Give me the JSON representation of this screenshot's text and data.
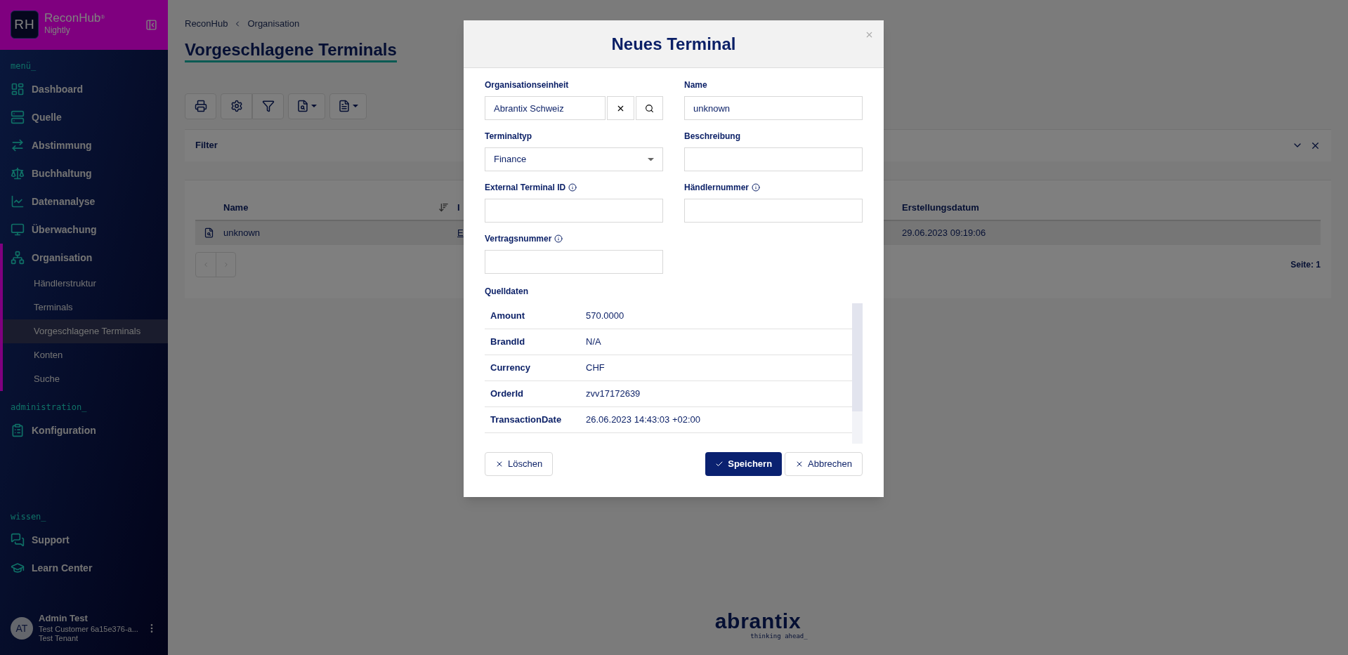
{
  "sidebar": {
    "brand": {
      "logo": "RH",
      "name": "ReconHub",
      "mark": "®",
      "subtitle": "Nightly"
    },
    "sections": [
      {
        "heading": "menü_",
        "items": [
          {
            "label": "Dashboard",
            "expanded": false
          },
          {
            "label": "Quelle",
            "expanded": false
          },
          {
            "label": "Abstimmung",
            "expanded": false
          },
          {
            "label": "Buchhaltung",
            "expanded": false
          },
          {
            "label": "Datenanalyse",
            "expanded": false
          },
          {
            "label": "Überwachung",
            "expanded": false
          },
          {
            "label": "Organisation",
            "expanded": true,
            "children": [
              {
                "label": "Händlerstruktur",
                "selected": false
              },
              {
                "label": "Terminals",
                "selected": false
              },
              {
                "label": "Vorgeschlagene Terminals",
                "selected": true
              },
              {
                "label": "Konten",
                "selected": false
              },
              {
                "label": "Suche",
                "selected": false
              }
            ]
          }
        ]
      },
      {
        "heading": "administration_",
        "items": [
          {
            "label": "Konfiguration",
            "expanded": false
          }
        ]
      },
      {
        "heading": "wissen_",
        "items": [
          {
            "label": "Support",
            "expanded": false
          },
          {
            "label": "Learn Center",
            "expanded": false
          }
        ]
      }
    ],
    "user": {
      "initials": "AT",
      "name": "Admin Test",
      "customer": "Test Customer 6a15e376-a...",
      "tenant": "Test Tenant"
    }
  },
  "main": {
    "breadcrumb": [
      "ReconHub",
      "Organisation"
    ],
    "title": "Vorgeschlagene Terminals",
    "filter": {
      "label": "Filter"
    },
    "table": {
      "columns": [
        "Name",
        "I",
        "Erstellungsdatum"
      ],
      "rows": [
        {
          "cells": [
            "unknown",
            "E",
            "29.06.2023 09:19:06"
          ]
        }
      ]
    },
    "pager": "Seite: 1",
    "footer": {
      "name": "abrantix",
      "tagline": "thinking ahead_"
    }
  },
  "modal": {
    "title": "Neues Terminal",
    "fields": [
      {
        "kind": "lookup",
        "label": "Organisationseinheit",
        "value": "Abrantix Schweiz",
        "info": false
      },
      {
        "kind": "text",
        "label": "Name",
        "value": "unknown",
        "info": false
      },
      {
        "kind": "select",
        "label": "Terminaltyp",
        "value": "Finance",
        "info": false
      },
      {
        "kind": "text",
        "label": "Beschreibung",
        "info": false
      },
      {
        "kind": "text",
        "label": "External Terminal ID",
        "info": true
      },
      {
        "kind": "text",
        "label": "Händlernummer",
        "info": true
      },
      {
        "kind": "text",
        "label": "Vertragsnummer",
        "info": true
      }
    ],
    "source_label": "Quelldaten",
    "source_rows": [
      {
        "key": "Amount",
        "value": "570.0000"
      },
      {
        "key": "BrandId",
        "value": "N/A"
      },
      {
        "key": "Currency",
        "value": "CHF"
      },
      {
        "key": "OrderId",
        "value": "zvv17172639"
      },
      {
        "key": "TransactionDate",
        "value": "26.06.2023 14:43:03 +02:00"
      }
    ],
    "buttons": [
      {
        "kind": "delete",
        "label": "Löschen"
      },
      {
        "kind": "save",
        "label": "Speichern"
      },
      {
        "kind": "cancel",
        "label": "Abbrechen"
      }
    ]
  }
}
